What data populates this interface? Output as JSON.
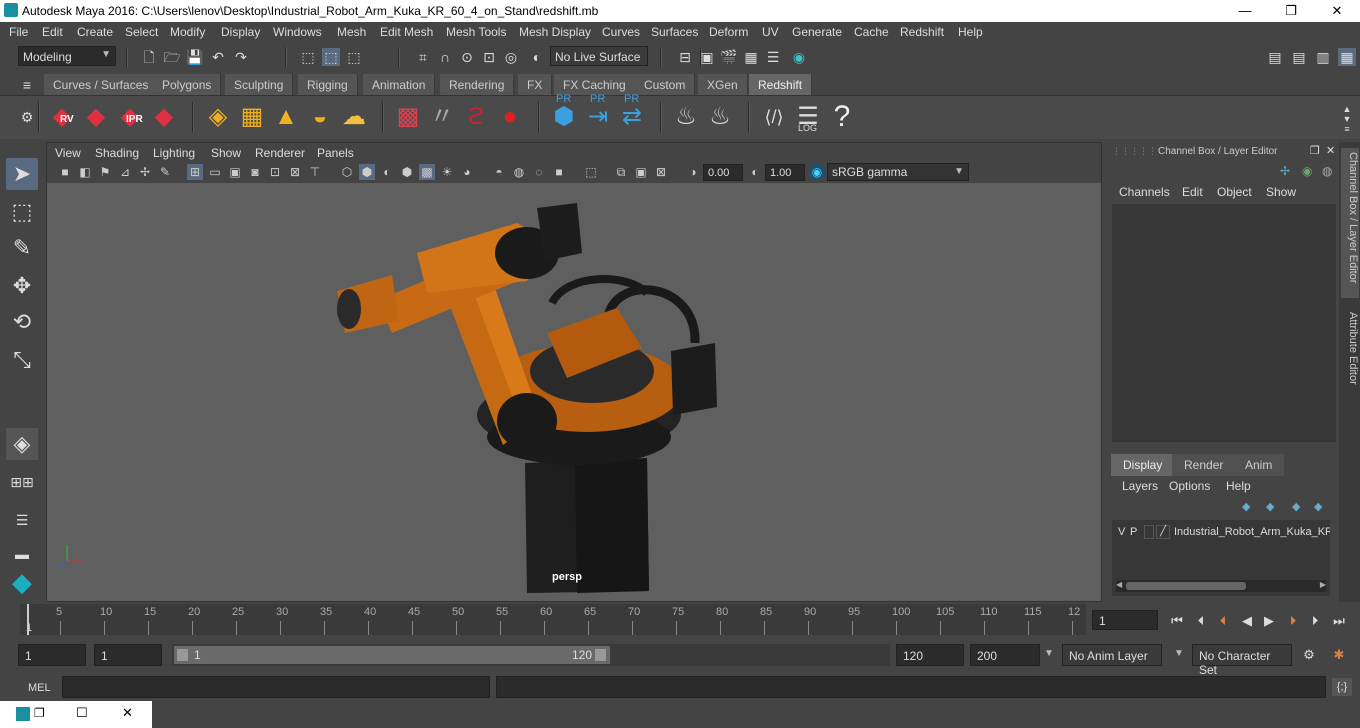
{
  "window": {
    "title": "Autodesk Maya 2016: C:\\Users\\lenov\\Desktop\\Industrial_Robot_Arm_Kuka_KR_60_4_on_Stand\\redshift.mb",
    "minimize": "—",
    "maximize": "❐",
    "close": "✕"
  },
  "menubar": [
    "File",
    "Edit",
    "Create",
    "Select",
    "Modify",
    "Display",
    "Windows",
    "Mesh",
    "Edit Mesh",
    "Mesh Tools",
    "Mesh Display",
    "Curves",
    "Surfaces",
    "Deform",
    "UV",
    "Generate",
    "Cache",
    "Redshift",
    "Help"
  ],
  "status": {
    "mode": "Modeling",
    "live_surface": "No Live Surface"
  },
  "shelf_tabs": [
    "Curves / Surfaces",
    "Polygons",
    "Sculpting",
    "Rigging",
    "Animation",
    "Rendering",
    "FX",
    "FX Caching",
    "Custom",
    "XGen",
    "Redshift"
  ],
  "shelf_active": "Redshift",
  "shelf_labels": {
    "rv": "RV",
    "ipr": "IPR",
    "pr1": "PR",
    "pr2": "PR",
    "pr3": "PR",
    "log": "LOG",
    "help": "?"
  },
  "viewport": {
    "menus": [
      "View",
      "Shading",
      "Lighting",
      "Show",
      "Renderer",
      "Panels"
    ],
    "exposure": "0.00",
    "gamma": "1.00",
    "colorspace": "sRGB gamma",
    "camera": "persp"
  },
  "channel_box": {
    "title": "Channel Box / Layer Editor",
    "menus": [
      "Channels",
      "Edit",
      "Object",
      "Show"
    ],
    "layer_tabs": [
      "Display",
      "Render",
      "Anim"
    ],
    "layer_menus": [
      "Layers",
      "Options",
      "Help"
    ],
    "layer": {
      "v": "V",
      "p": "P",
      "name": "Industrial_Robot_Arm_Kuka_KR"
    }
  },
  "side_tabs": [
    "Channel Box / Layer Editor",
    "Attribute Editor"
  ],
  "timeline": {
    "ticks": [
      "5",
      "10",
      "15",
      "20",
      "25",
      "30",
      "35",
      "40",
      "45",
      "50",
      "55",
      "60",
      "65",
      "70",
      "75",
      "80",
      "85",
      "90",
      "95",
      "100",
      "105",
      "110",
      "115",
      "12"
    ],
    "start_mark": "1",
    "current_frame": "1"
  },
  "range": {
    "start": "1",
    "playback_start": "1",
    "slider_start": "1",
    "slider_end": "120",
    "playback_end": "120",
    "end": "200",
    "anim_layer": "No Anim Layer",
    "char_set": "No Character Set"
  },
  "cmdline": {
    "label": "MEL"
  }
}
